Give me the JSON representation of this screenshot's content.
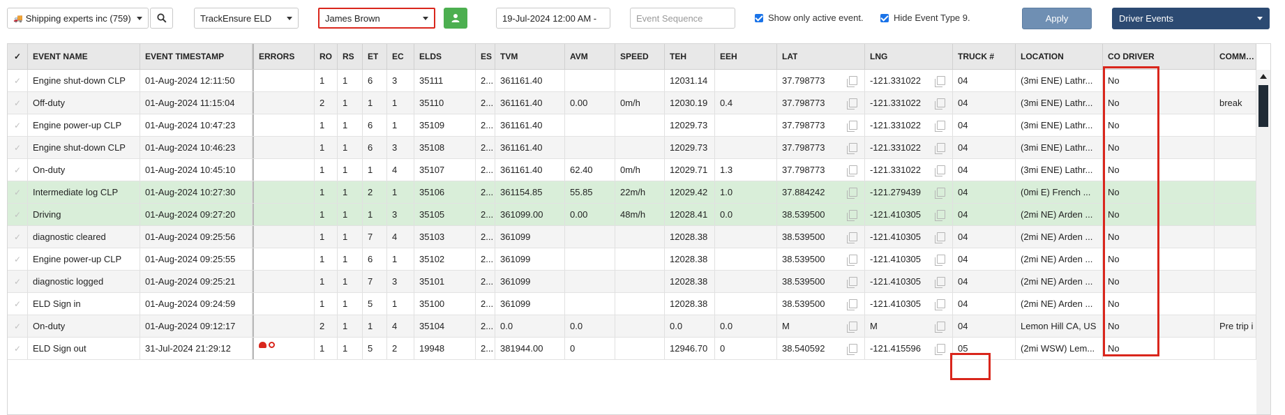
{
  "toolbar": {
    "company": "Shipping experts inc (759)",
    "eld_provider": "TrackEnsure ELD",
    "driver": "James Brown",
    "date_range": "19-Jul-2024 12:00 AM -",
    "event_sequence_placeholder": "Event Sequence",
    "show_active_label": "Show only active event.",
    "hide_type_label": "Hide Event Type 9.",
    "apply_label": "Apply",
    "event_type": "Driver Events"
  },
  "columns": [
    "EVENT NAME",
    "EVENT TIMESTAMP",
    "ERRORS",
    "RO",
    "RS",
    "ET",
    "EC",
    "ELDS",
    "ES",
    "TVM",
    "AVM",
    "SPEED",
    "TEH",
    "EEH",
    "LAT",
    "LNG",
    "TRUCK #",
    "LOCATION",
    "CO DRIVER",
    "COMMENT"
  ],
  "rows": [
    {
      "name": "Engine shut-down CLP",
      "ts": "01-Aug-2024 12:11:50",
      "err": "",
      "ro": "1",
      "rs": "1",
      "et": "6",
      "ec": "3",
      "elds": "35111",
      "es": "2...",
      "tvm": "361161.40",
      "avm": "",
      "speed": "",
      "teh": "12031.14",
      "eeh": "",
      "lat": "37.798773",
      "lng": "-121.331022",
      "truck": "04",
      "loc": "(3mi ENE) Lathr...",
      "co": "No",
      "comment": "",
      "hl": false
    },
    {
      "name": "Off-duty",
      "ts": "01-Aug-2024 11:15:04",
      "err": "",
      "ro": "2",
      "rs": "1",
      "et": "1",
      "ec": "1",
      "elds": "35110",
      "es": "2...",
      "tvm": "361161.40",
      "avm": "0.00",
      "speed": "0m/h",
      "teh": "12030.19",
      "eeh": "0.4",
      "lat": "37.798773",
      "lng": "-121.331022",
      "truck": "04",
      "loc": "(3mi ENE) Lathr...",
      "co": "No",
      "comment": "break",
      "hl": false
    },
    {
      "name": "Engine power-up CLP",
      "ts": "01-Aug-2024 10:47:23",
      "err": "",
      "ro": "1",
      "rs": "1",
      "et": "6",
      "ec": "1",
      "elds": "35109",
      "es": "2...",
      "tvm": "361161.40",
      "avm": "",
      "speed": "",
      "teh": "12029.73",
      "eeh": "",
      "lat": "37.798773",
      "lng": "-121.331022",
      "truck": "04",
      "loc": "(3mi ENE) Lathr...",
      "co": "No",
      "comment": "",
      "hl": false
    },
    {
      "name": "Engine shut-down CLP",
      "ts": "01-Aug-2024 10:46:23",
      "err": "",
      "ro": "1",
      "rs": "1",
      "et": "6",
      "ec": "3",
      "elds": "35108",
      "es": "2...",
      "tvm": "361161.40",
      "avm": "",
      "speed": "",
      "teh": "12029.73",
      "eeh": "",
      "lat": "37.798773",
      "lng": "-121.331022",
      "truck": "04",
      "loc": "(3mi ENE) Lathr...",
      "co": "No",
      "comment": "",
      "hl": false
    },
    {
      "name": "On-duty",
      "ts": "01-Aug-2024 10:45:10",
      "err": "",
      "ro": "1",
      "rs": "1",
      "et": "1",
      "ec": "4",
      "elds": "35107",
      "es": "2...",
      "tvm": "361161.40",
      "avm": "62.40",
      "speed": "0m/h",
      "teh": "12029.71",
      "eeh": "1.3",
      "lat": "37.798773",
      "lng": "-121.331022",
      "truck": "04",
      "loc": "(3mi ENE) Lathr...",
      "co": "No",
      "comment": "",
      "hl": false
    },
    {
      "name": "Intermediate log CLP",
      "ts": "01-Aug-2024 10:27:30",
      "err": "",
      "ro": "1",
      "rs": "1",
      "et": "2",
      "ec": "1",
      "elds": "35106",
      "es": "2...",
      "tvm": "361154.85",
      "avm": "55.85",
      "speed": "22m/h",
      "teh": "12029.42",
      "eeh": "1.0",
      "lat": "37.884242",
      "lng": "-121.279439",
      "truck": "04",
      "loc": "(0mi E) French ...",
      "co": "No",
      "comment": "",
      "hl": true
    },
    {
      "name": "Driving",
      "ts": "01-Aug-2024 09:27:20",
      "err": "",
      "ro": "1",
      "rs": "1",
      "et": "1",
      "ec": "3",
      "elds": "35105",
      "es": "2...",
      "tvm": "361099.00",
      "avm": "0.00",
      "speed": "48m/h",
      "teh": "12028.41",
      "eeh": "0.0",
      "lat": "38.539500",
      "lng": "-121.410305",
      "truck": "04",
      "loc": "(2mi NE) Arden ...",
      "co": "No",
      "comment": "",
      "hl": true
    },
    {
      "name": "diagnostic cleared",
      "ts": "01-Aug-2024 09:25:56",
      "err": "",
      "ro": "1",
      "rs": "1",
      "et": "7",
      "ec": "4",
      "elds": "35103",
      "es": "2...",
      "tvm": "361099",
      "avm": "",
      "speed": "",
      "teh": "12028.38",
      "eeh": "",
      "lat": "38.539500",
      "lng": "-121.410305",
      "truck": "04",
      "loc": "(2mi NE) Arden ...",
      "co": "No",
      "comment": "",
      "hl": false
    },
    {
      "name": "Engine power-up CLP",
      "ts": "01-Aug-2024 09:25:55",
      "err": "",
      "ro": "1",
      "rs": "1",
      "et": "6",
      "ec": "1",
      "elds": "35102",
      "es": "2...",
      "tvm": "361099",
      "avm": "",
      "speed": "",
      "teh": "12028.38",
      "eeh": "",
      "lat": "38.539500",
      "lng": "-121.410305",
      "truck": "04",
      "loc": "(2mi NE) Arden ...",
      "co": "No",
      "comment": "",
      "hl": false
    },
    {
      "name": "diagnostic logged",
      "ts": "01-Aug-2024 09:25:21",
      "err": "",
      "ro": "1",
      "rs": "1",
      "et": "7",
      "ec": "3",
      "elds": "35101",
      "es": "2...",
      "tvm": "361099",
      "avm": "",
      "speed": "",
      "teh": "12028.38",
      "eeh": "",
      "lat": "38.539500",
      "lng": "-121.410305",
      "truck": "04",
      "loc": "(2mi NE) Arden ...",
      "co": "No",
      "comment": "",
      "hl": false
    },
    {
      "name": "ELD Sign in",
      "ts": "01-Aug-2024 09:24:59",
      "err": "",
      "ro": "1",
      "rs": "1",
      "et": "5",
      "ec": "1",
      "elds": "35100",
      "es": "2...",
      "tvm": "361099",
      "avm": "",
      "speed": "",
      "teh": "12028.38",
      "eeh": "",
      "lat": "38.539500",
      "lng": "-121.410305",
      "truck": "04",
      "loc": "(2mi NE) Arden ...",
      "co": "No",
      "comment": "",
      "hl": false
    },
    {
      "name": "On-duty",
      "ts": "01-Aug-2024 09:12:17",
      "err": "",
      "ro": "2",
      "rs": "1",
      "et": "1",
      "ec": "4",
      "elds": "35104",
      "es": "2...",
      "tvm": "0.0",
      "avm": "0.0",
      "speed": "",
      "teh": "0.0",
      "eeh": "0.0",
      "lat": "M",
      "lng": "M",
      "truck": "04",
      "loc": "Lemon Hill CA, US",
      "co": "No",
      "comment": "Pre trip i",
      "hl": false
    },
    {
      "name": "ELD Sign out",
      "ts": "31-Jul-2024 21:29:12",
      "err": "icons",
      "ro": "1",
      "rs": "1",
      "et": "5",
      "ec": "2",
      "elds": "19948",
      "es": "2...",
      "tvm": "381944.00",
      "avm": "0",
      "speed": "",
      "teh": "12946.70",
      "eeh": "0",
      "lat": "38.540592",
      "lng": "-121.415596",
      "truck": "05",
      "loc": "(2mi WSW) Lem...",
      "co": "No",
      "comment": "",
      "hl": false
    }
  ],
  "colors": {
    "highlight": "#d9eed9",
    "apply": "#6f8fb3",
    "event_type": "#2c4a72",
    "user_button": "#4caf50",
    "annotation": "#d9261c"
  }
}
